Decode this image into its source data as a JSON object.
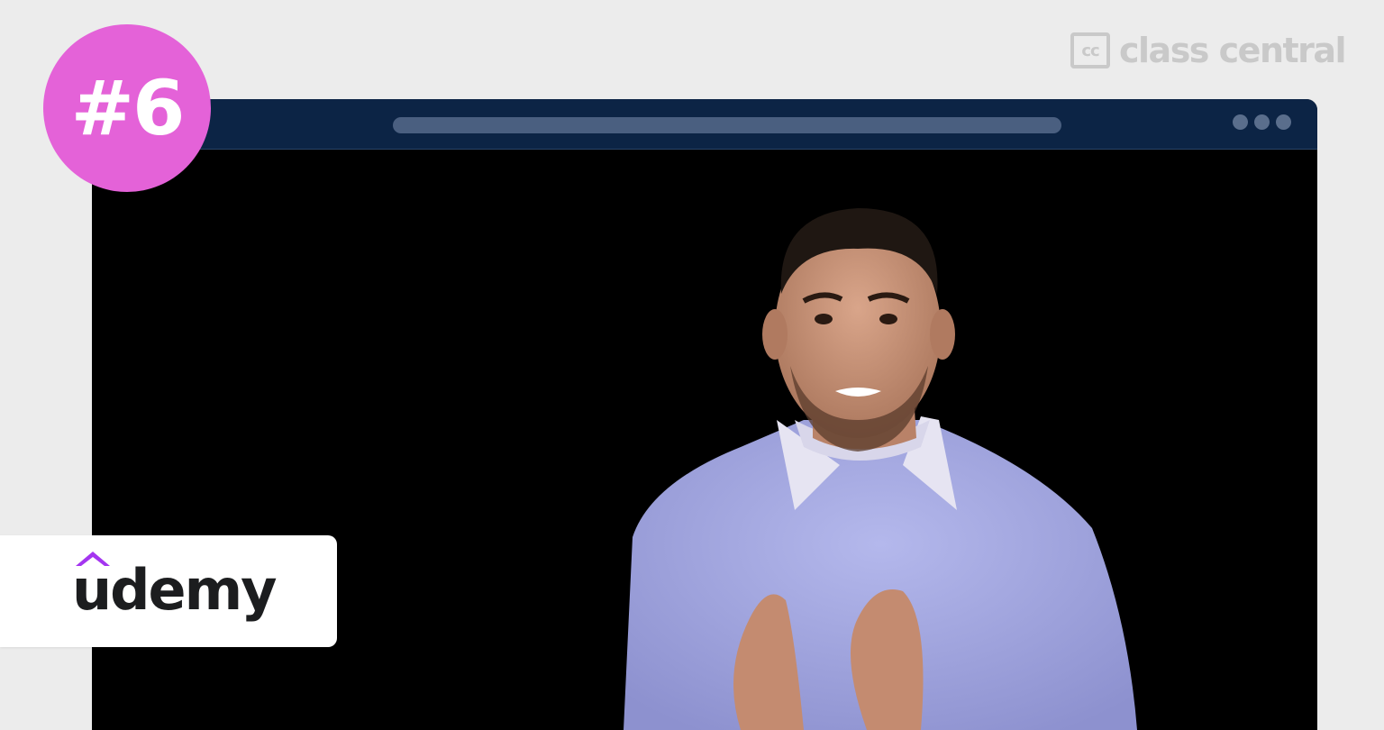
{
  "rank_badge": {
    "text": "#6",
    "color": "#e462d8"
  },
  "class_central": {
    "mark": "cc",
    "name": "class central"
  },
  "browser": {
    "bar_color": "#0c2445",
    "window_dots": [
      "dot",
      "dot",
      "dot"
    ]
  },
  "video": {
    "subject": "instructor-video-frame"
  },
  "provider": {
    "name": "udemy",
    "accent_color": "#a435f0"
  }
}
